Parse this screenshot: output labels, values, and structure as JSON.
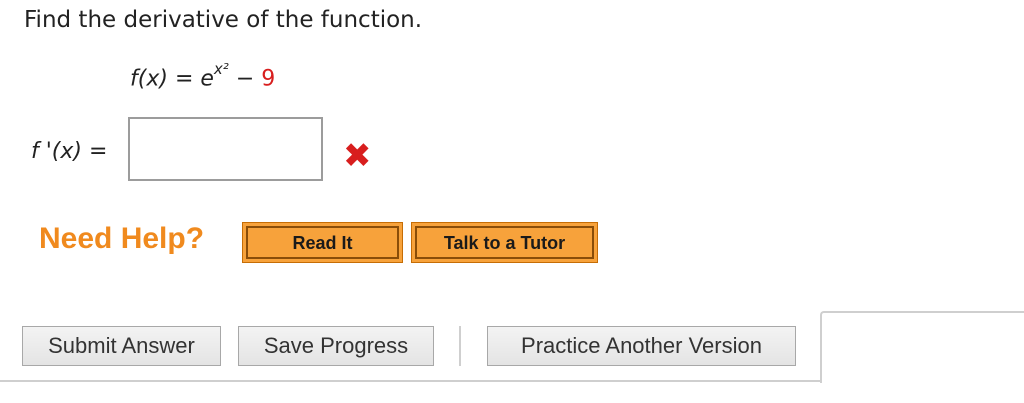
{
  "question": {
    "prompt": "Find the derivative of the function.",
    "function": {
      "lhs": "f(x)",
      "equals": "=",
      "base": "e",
      "exponent": "x²",
      "minus": "−",
      "constant": "9"
    }
  },
  "answer": {
    "label_func": "f '(x)",
    "equals": "=",
    "value": "",
    "status": "incorrect",
    "status_icon": "red-x-icon",
    "status_glyph": "✖"
  },
  "help": {
    "label": "Need Help?",
    "read_it": "Read It",
    "tutor": "Talk to a Tutor"
  },
  "actions": {
    "submit": "Submit Answer",
    "save": "Save Progress",
    "practice": "Practice Another Version"
  },
  "colors": {
    "accent_red": "#d81e1e",
    "help_orange": "#f08a1e",
    "help_button": "#f7a23b"
  }
}
